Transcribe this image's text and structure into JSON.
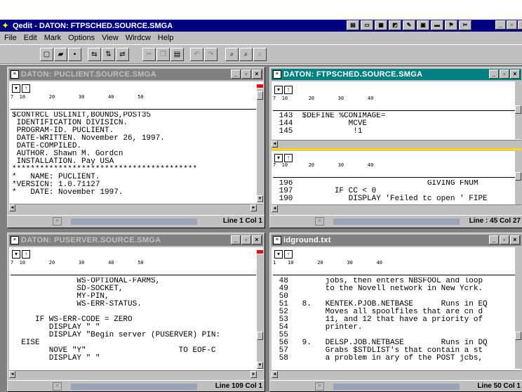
{
  "app": {
    "title": "Qedit - DATON: FTPSCHED.SOURCE.SMGA"
  },
  "menu": {
    "file": "File",
    "edit": "Edit",
    "mark": "Mark",
    "options": "Options",
    "view": "View",
    "window": "Wirdcw",
    "help": "Help"
  },
  "windows": [
    {
      "title": "DATON: PUCLIENT.SOURCE.SMGA",
      "status": "Line 1 Col 1",
      "ruler": "7  10        20        30        40        50",
      "lines": [
        "$CONTRCL USLINIT,BOUNDS,POST35",
        " IDENTIFICATION DIVISICN.",
        " PROGRAM-ID. PUCLIENT.",
        " DATE-WRITTEN. November 26, 1997.",
        " DATE-COMPILED.",
        " AUTHOR. Shawn M. Gordcn",
        " INSTALLATION. Pay USA",
        "****************************************",
        "*   NAME: PUCLIENT.",
        "*VERSICN: 1.0.71127",
        "*   DATE: November 1997."
      ]
    },
    {
      "title": "DATON: FTPSCHED.SOURCE.SMGA",
      "status": "Line : 45 Col 27",
      "ruler": "7  10       20        30        40",
      "lines_top": [
        " 143  $DEFINE %CONIMAGE=",
        " 144            MCVE",
        " 145             !1"
      ],
      "lines_bottom": [
        " 196                             GIVING FNUM",
        " 197         IF CC < 0",
        " 190            DISPLAY 'Feiled tc open ' FIPE"
      ]
    },
    {
      "title": "DATON: PUSERVER.SOURCE.SMGA",
      "status": "Line 109 Col 1",
      "ruler": "7  10        20        30        40        50",
      "lines": [
        "              WS-OPTIONAL-FARMS,",
        "              SD-SOCKET,",
        "              MY-PIN,",
        "              WS-ERR-STATUS.",
        "",
        "     IF WS-ERR-CODE = ZERO",
        "        DISPLAY \" \"",
        "        DISPLAY \"Begin server (PUSERVER) PIN:",
        "  EISE",
        "        NOVE \"Y\"                    TO EOF-C",
        "        DISPLAY \" \""
      ]
    },
    {
      "title": "idground.txt",
      "status": "Line 50 Col 1",
      "ruler": "1    10        20        30        40",
      "lines": [
        " 48        jobs, then enters NBSFOOL and loop",
        " 49        to the Novell network in New Ycrk.",
        " 50",
        " 51   8.   KENTEK.PJOB.NETBASE      Runs in EQ",
        " 52        Moves all spoolfiles that are cn d",
        " 53        11, and 12 that have a priority of",
        " 54        printer.",
        " 55",
        " 56   9.   DELSP.JOB.NETBASE        Runs in DQ",
        " 57        Grabs $STDLIST's that contain a st",
        " 58        a problem in ary of the POST jcbs,"
      ]
    }
  ]
}
